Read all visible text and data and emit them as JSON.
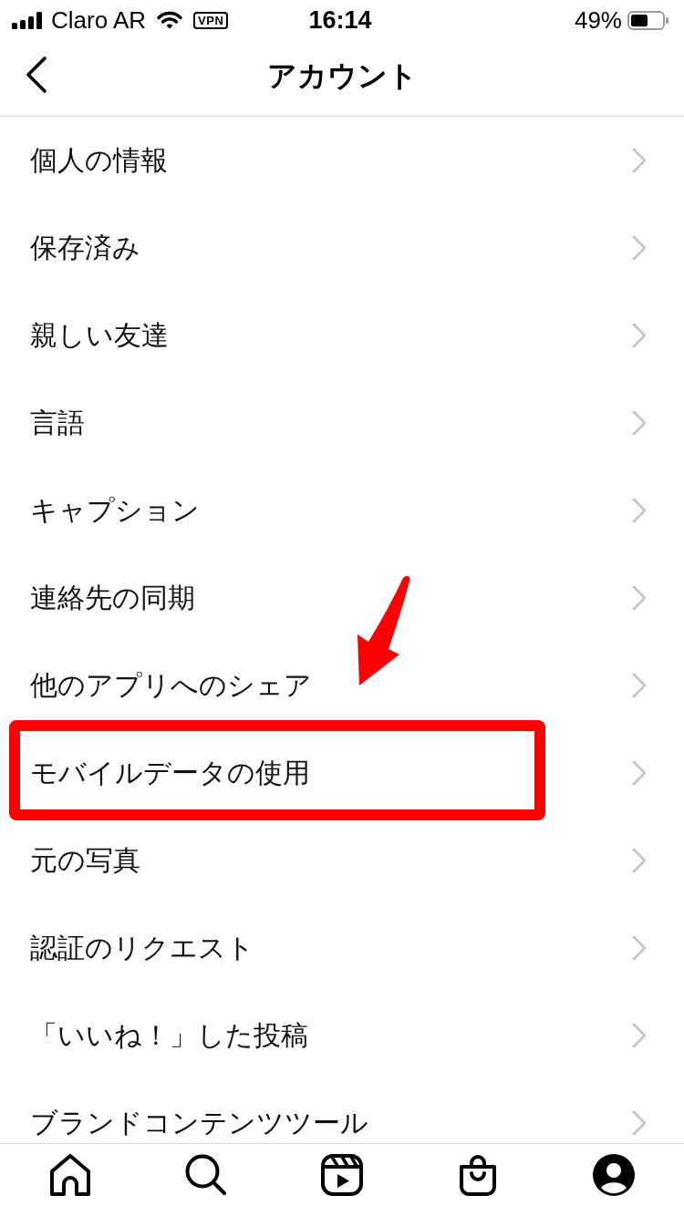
{
  "status_bar": {
    "carrier": "Claro AR",
    "vpn": "VPN",
    "time": "16:14",
    "battery": "49%"
  },
  "header": {
    "title": "アカウント"
  },
  "menu": {
    "items": [
      {
        "label": "個人の情報",
        "highlighted": false
      },
      {
        "label": "保存済み",
        "highlighted": false
      },
      {
        "label": "親しい友達",
        "highlighted": false
      },
      {
        "label": "言語",
        "highlighted": false
      },
      {
        "label": "キャプション",
        "highlighted": false
      },
      {
        "label": "連絡先の同期",
        "highlighted": false
      },
      {
        "label": "他のアプリへのシェア",
        "highlighted": false
      },
      {
        "label": "モバイルデータの使用",
        "highlighted": true
      },
      {
        "label": "元の写真",
        "highlighted": false
      },
      {
        "label": "認証のリクエスト",
        "highlighted": false
      },
      {
        "label": "「いいね！」した投稿",
        "highlighted": false
      },
      {
        "label": "ブランドコンテンツツール",
        "highlighted": false
      }
    ]
  },
  "tab_bar": {
    "items": [
      {
        "kind": "home"
      },
      {
        "kind": "search"
      },
      {
        "kind": "reels"
      },
      {
        "kind": "shop"
      },
      {
        "kind": "profile"
      }
    ]
  }
}
